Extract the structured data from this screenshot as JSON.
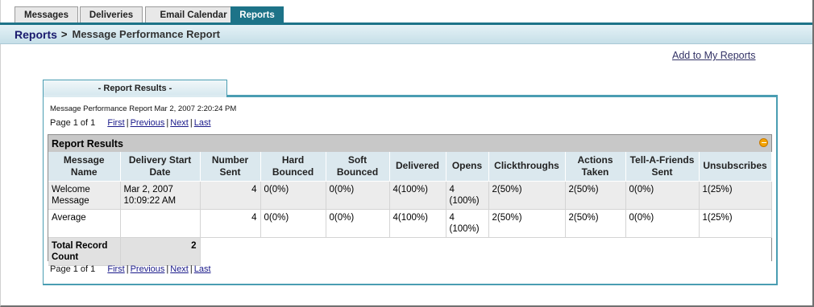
{
  "tabs": [
    {
      "label": "Messages",
      "active": false
    },
    {
      "label": "Deliveries",
      "active": false
    },
    {
      "label": "Email Calendar",
      "active": false
    },
    {
      "label": "Reports",
      "active": true
    }
  ],
  "breadcrumb": {
    "root": "Reports",
    "separator": ">",
    "page": "Message Performance Report"
  },
  "add_link": "Add to My Reports",
  "panel_tab": "- Report Results -",
  "meta_line": "Message Performance Report Mar 2, 2007 2:20:24 PM",
  "pager": {
    "text": "Page 1 of 1",
    "first": "First",
    "previous": "Previous",
    "next": "Next",
    "last": "Last"
  },
  "results": {
    "title": "Report Results",
    "columns": [
      "Message Name",
      "Delivery Start Date",
      "Number Sent",
      "Hard Bounced",
      "Soft Bounced",
      "Delivered",
      "Opens",
      "Clickthroughs",
      "Actions Taken",
      "Tell-A-Friends Sent",
      "Unsubscribes"
    ],
    "rows": [
      [
        "Welcome Message",
        "Mar 2, 2007 10:09:22 AM",
        "4",
        "0(0%)",
        "0(0%)",
        "4(100%)",
        "4 (100%)",
        "2(50%)",
        "2(50%)",
        "0(0%)",
        "1(25%)"
      ],
      [
        "Average",
        "",
        "4",
        "0(0%)",
        "0(0%)",
        "4(100%)",
        "4 (100%)",
        "2(50%)",
        "2(50%)",
        "0(0%)",
        "1(25%)"
      ]
    ],
    "total_label": "Total Record Count",
    "total_value": "2"
  },
  "colors": {
    "accent": "#1d7388",
    "banner": "#c6dfe8",
    "header_cell": "#dbe8ee"
  }
}
